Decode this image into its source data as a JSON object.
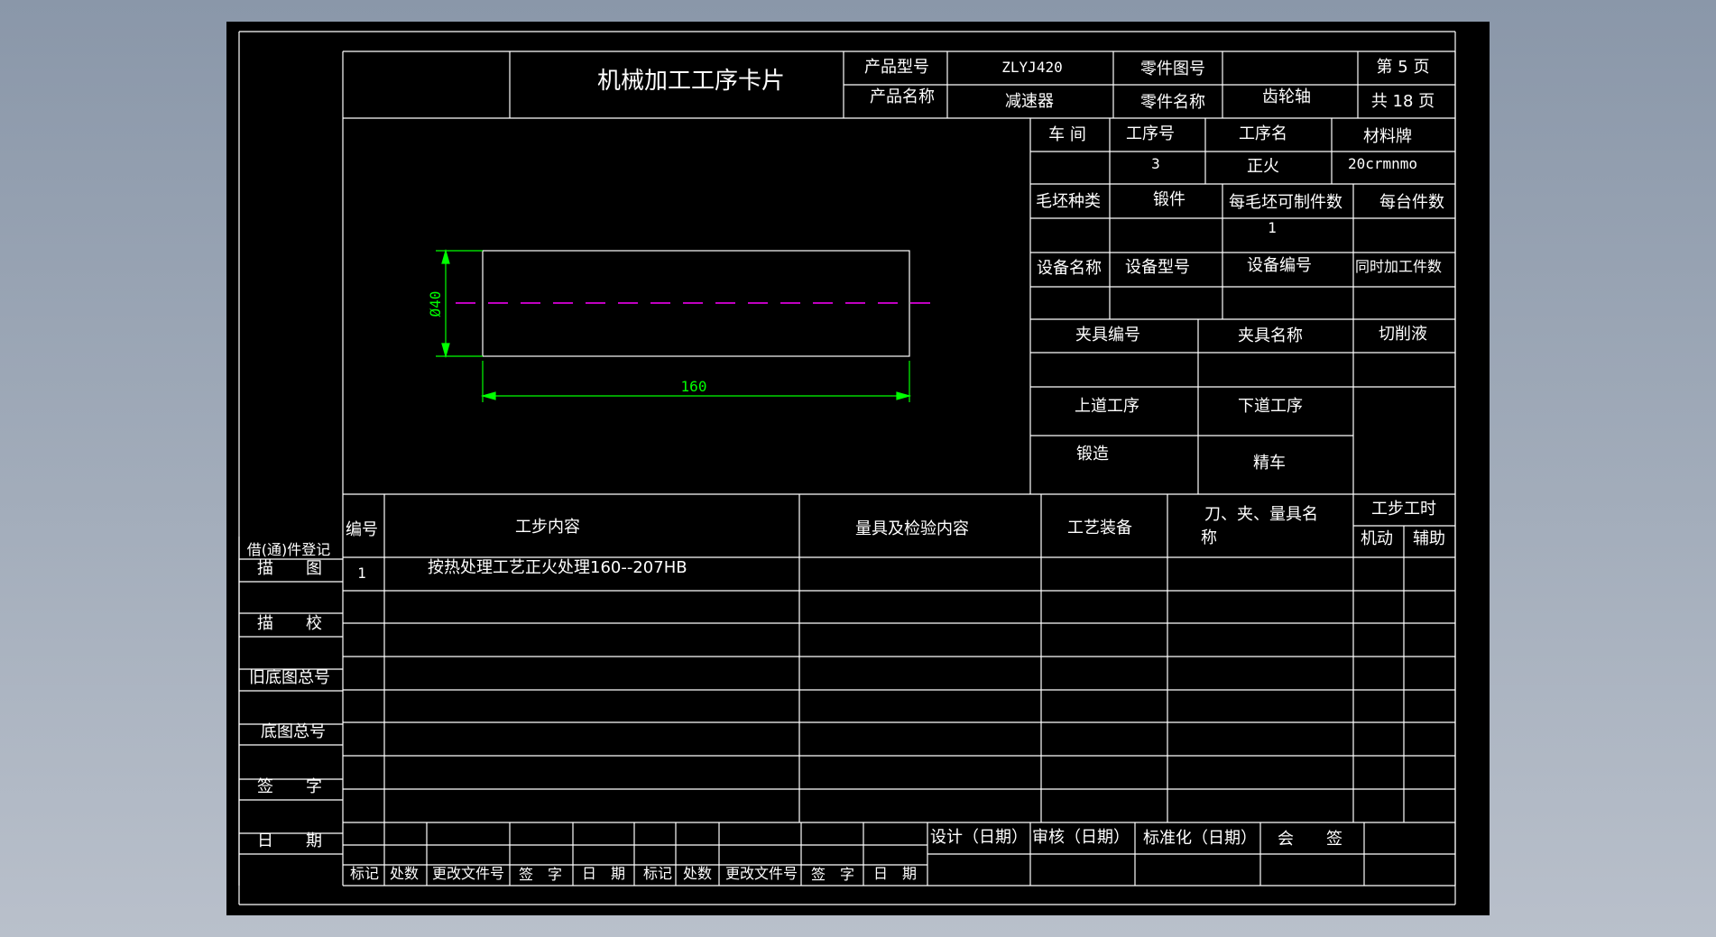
{
  "card": {
    "title": "机械加工工序卡片",
    "product_model_label": "产品型号",
    "product_model": "ZLYJ420",
    "part_no_label": "零件图号",
    "part_no": "",
    "page_label": "第 5 页",
    "product_name_label": "产品名称",
    "product_name": "减速器",
    "part_name_label": "零件名称",
    "part_name": "齿轮轴",
    "total_label": "共 18 页"
  },
  "info": {
    "workshop_label": "车 间",
    "op_no_label": "工序号",
    "op_name_label": "工序名",
    "material_label": "材料牌",
    "workshop": "",
    "op_no": "3",
    "op_name": "正火",
    "material": "20crmnmo",
    "blank_type_label": "毛坯种类",
    "blank_type": "锻件",
    "per_blank_label": "每毛坯可制件数",
    "per_unit_label": "每台件数",
    "per_blank": "1",
    "equip_name_label": "设备名称",
    "equip_model_label": "设备型号",
    "equip_no_label": "设备编号",
    "simul_label": "同时加工件数",
    "fixture_no_label": "夹具编号",
    "fixture_name_label": "夹具名称",
    "coolant_label": "切削液",
    "prev_op_label": "上道工序",
    "next_op_label": "下道工序",
    "prev_op": "锻造",
    "next_op": "精车"
  },
  "drawing": {
    "diameter_dim": "Ø40",
    "length_dim": "160"
  },
  "steps": {
    "headers": {
      "no": "编号",
      "content": "工步内容",
      "inspect": "量具及检验内容",
      "equip": "工艺装备",
      "tools_1": "刀、夹、量具名",
      "tools_2": "称",
      "time": "工步工时",
      "machine": "机动",
      "aux": "辅助"
    },
    "rows": [
      {
        "no": "1",
        "content": "按热处理工艺正火处理160--207HB"
      }
    ]
  },
  "left_column": {
    "register": "借(通)件登记",
    "trace": "描　　图",
    "check": "描　　校",
    "old_base": "旧底图总号",
    "base": "底图总号",
    "sign": "签　　字",
    "date": "日　　期"
  },
  "footer": {
    "mark": "标记",
    "count": "处数",
    "change_doc": "更改文件号",
    "signature": "签　字",
    "date": "日　期",
    "design": "设计（日期）",
    "review": "审核（日期）",
    "standard": "标准化（日期）",
    "countersign": "会　　签"
  },
  "colors": {
    "frame": "#000000",
    "lines": "#ffffff",
    "dimension": "#00ff00",
    "centerline": "#ff00ff"
  }
}
